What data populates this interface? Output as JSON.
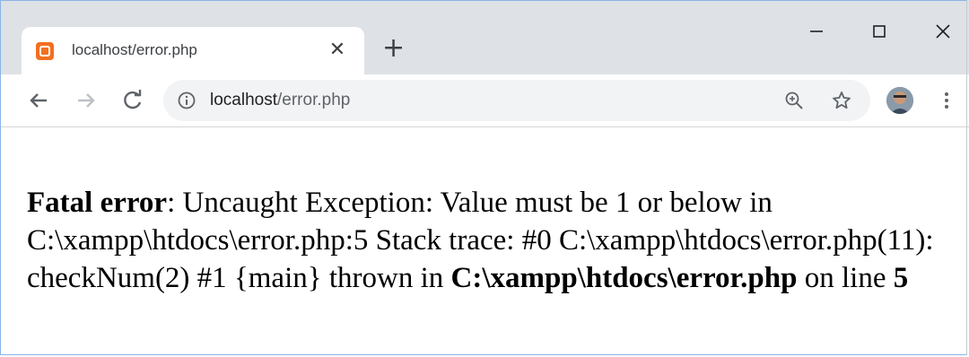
{
  "tab": {
    "title": "localhost/error.php",
    "close": "✕",
    "new_tab": "+"
  },
  "window": {
    "min": "–",
    "max": "☐",
    "close": "✕"
  },
  "address": {
    "host": "localhost",
    "path": "/error.php"
  },
  "error": {
    "label": "Fatal error",
    "text1": ": Uncaught Exception: Value must be 1 or below in C:\\xampp\\htdocs\\error.php:5 Stack trace: #0 C:\\xampp\\htdocs\\error.php(11): checkNum(2) #1 {main} thrown in ",
    "file": "C:\\xampp\\htdocs\\error.php",
    "text2": " on line ",
    "line": "5"
  }
}
